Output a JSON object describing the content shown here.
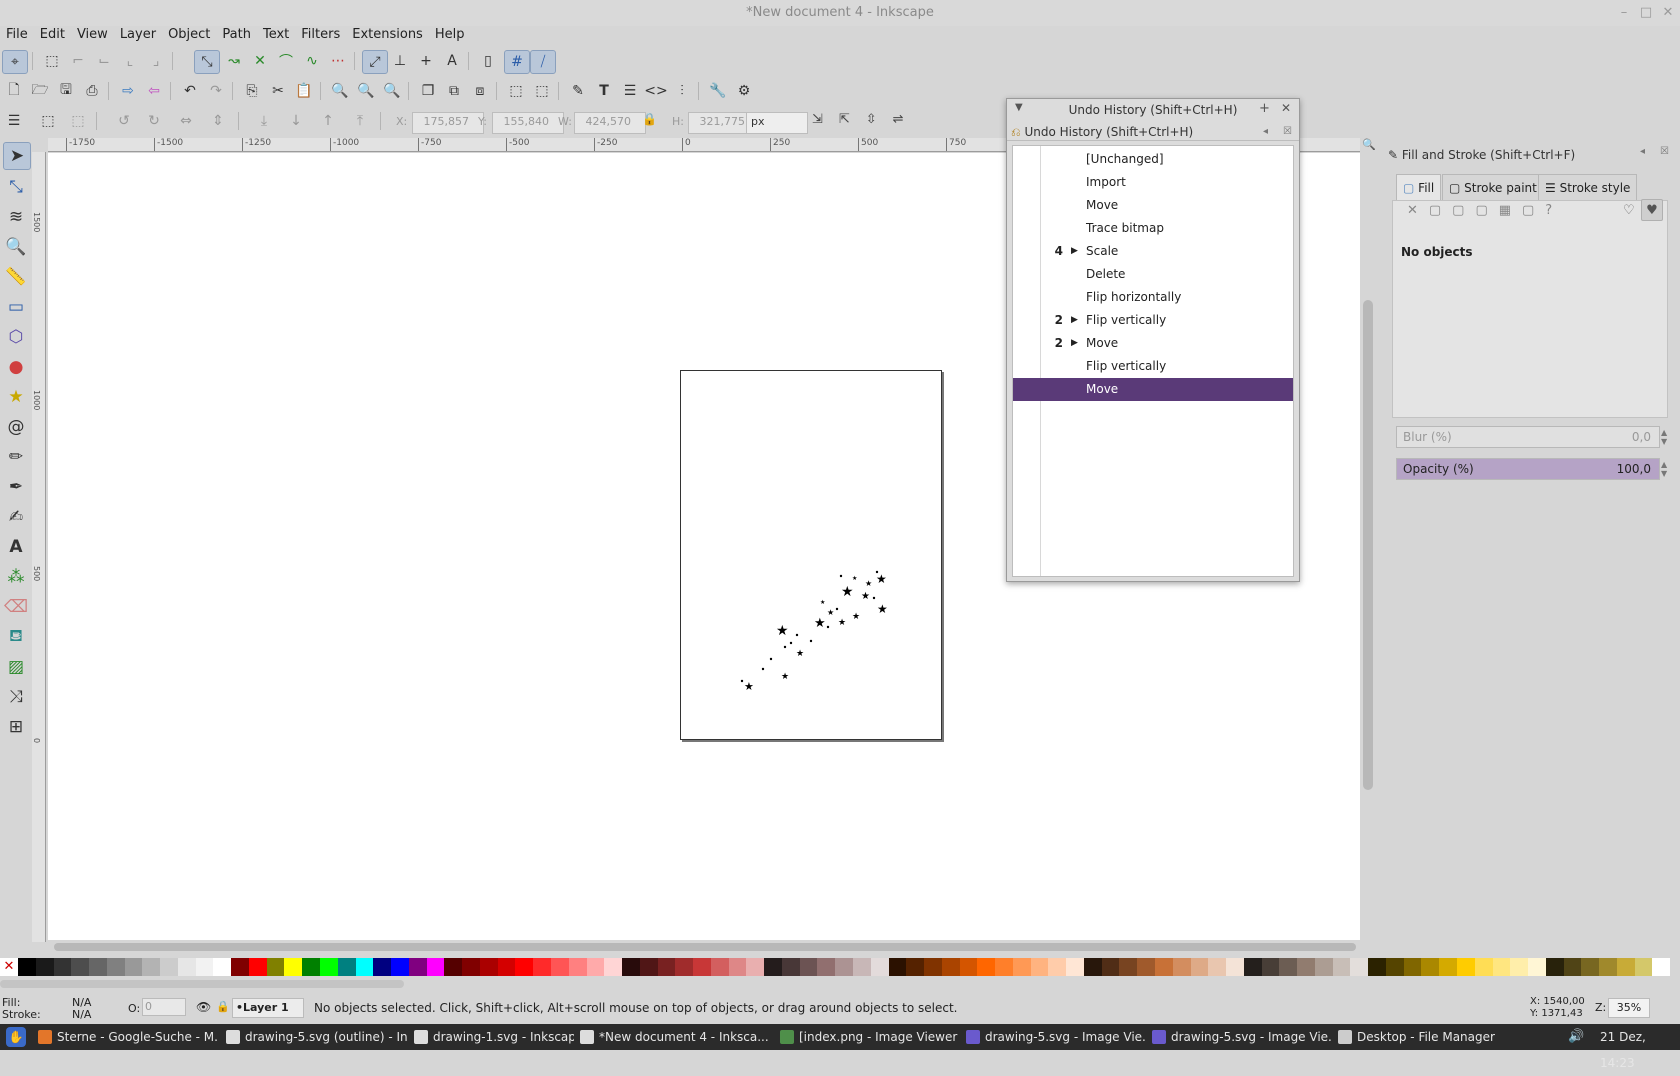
{
  "window": {
    "title": "*New document 4 - Inkscape"
  },
  "menu": [
    "File",
    "Edit",
    "View",
    "Layer",
    "Object",
    "Path",
    "Text",
    "Filters",
    "Extensions",
    "Help"
  ],
  "toolbar": {
    "x_label": "X:",
    "x_value": "175,857",
    "y_label": "Y:",
    "y_value": "155,840",
    "w_label": "W:",
    "w_value": "424,570",
    "h_label": "H:",
    "h_value": "321,775",
    "unit": "px"
  },
  "rulers": {
    "horizontal": [
      "-1750",
      "-1500",
      "-1250",
      "-1000",
      "-750",
      "-500",
      "-250",
      "0",
      "250",
      "500",
      "750"
    ],
    "vertical": [
      "1500",
      "1000",
      "500",
      "0"
    ]
  },
  "undo_history": {
    "title": "Undo History (Shift+Ctrl+H)",
    "header": "Undo History (Shift+Ctrl+H)",
    "items": [
      {
        "count": "",
        "expander": false,
        "label": "[Unchanged]",
        "selected": false
      },
      {
        "count": "",
        "expander": false,
        "label": "Import",
        "selected": false
      },
      {
        "count": "",
        "expander": false,
        "label": "Move",
        "selected": false
      },
      {
        "count": "",
        "expander": false,
        "label": "Trace bitmap",
        "selected": false
      },
      {
        "count": "4",
        "expander": true,
        "label": "Scale",
        "selected": false
      },
      {
        "count": "",
        "expander": false,
        "label": "Delete",
        "selected": false
      },
      {
        "count": "",
        "expander": false,
        "label": "Flip horizontally",
        "selected": false
      },
      {
        "count": "2",
        "expander": true,
        "label": "Flip vertically",
        "selected": false
      },
      {
        "count": "2",
        "expander": true,
        "label": "Move",
        "selected": false
      },
      {
        "count": "",
        "expander": false,
        "label": "Flip vertically",
        "selected": false
      },
      {
        "count": "",
        "expander": false,
        "label": "Move",
        "selected": true
      }
    ]
  },
  "fill_stroke": {
    "title": "Fill and Stroke (Shift+Ctrl+F)",
    "tabs": [
      "Fill",
      "Stroke paint",
      "Stroke style"
    ],
    "message": "No objects",
    "blur_label": "Blur (%)",
    "blur_value": "0,0",
    "opacity_label": "Opacity (%)",
    "opacity_value": "100,0",
    "opacity_fraction": 1.0
  },
  "status": {
    "fill_label": "Fill:",
    "fill_value": "N/A",
    "stroke_label": "Stroke:",
    "stroke_value": "N/A",
    "o_label": "O:",
    "o_value": "0",
    "layer": "•Layer 1",
    "message": "No objects selected. Click, Shift+click, Alt+scroll mouse on top of objects, or drag around objects to select.",
    "cursor_x": "X: 1540,00",
    "cursor_y": "Y: 1371,43",
    "zoom_label": "Z:",
    "zoom": "35%"
  },
  "taskbar": {
    "tasks": [
      {
        "label": "Sterne - Google-Suche - M...",
        "color": "#e3762a"
      },
      {
        "label": "drawing-5.svg (outline) - In...",
        "color": "#dddddd"
      },
      {
        "label": "drawing-1.svg - Inkscape",
        "color": "#dddddd"
      },
      {
        "label": "*New document 4 - Inksca...",
        "color": "#dddddd"
      },
      {
        "label": "[index.png - Image Viewer ...",
        "color": "#4f8f4a"
      },
      {
        "label": "drawing-5.svg - Image Vie...",
        "color": "#6a5acd"
      },
      {
        "label": "drawing-5.svg - Image Vie...",
        "color": "#6a5acd"
      },
      {
        "label": "Desktop - File Manager",
        "color": "#cccccc"
      }
    ],
    "clock": "21 Dez, 14:23"
  },
  "palette": [
    "#000000",
    "#1a1a1a",
    "#333333",
    "#4d4d4d",
    "#666666",
    "#808080",
    "#999999",
    "#b3b3b3",
    "#cccccc",
    "#e6e6e6",
    "#f2f2f2",
    "#ffffff",
    "#800000",
    "#ff0000",
    "#808000",
    "#ffff00",
    "#008000",
    "#00ff00",
    "#008080",
    "#00ffff",
    "#000080",
    "#0000ff",
    "#800080",
    "#ff00ff",
    "#550000",
    "#800000",
    "#aa0000",
    "#d40000",
    "#ff0000",
    "#ff2a2a",
    "#ff5555",
    "#ff8080",
    "#ffaaaa",
    "#ffd5d5",
    "#280b0b",
    "#501616",
    "#782121",
    "#a02c2c",
    "#c83737",
    "#d35f5f",
    "#de8787",
    "#e9afaf",
    "#241c1c",
    "#483737",
    "#6c5353",
    "#916f6f",
    "#ac9393",
    "#c8b7b7",
    "#e3dbdb",
    "#2b1100",
    "#552200",
    "#803300",
    "#aa4400",
    "#d45500",
    "#ff6600",
    "#ff7f2a",
    "#ff9955",
    "#ffb380",
    "#ffccaa",
    "#ffe6d5",
    "#28170b",
    "#502d16",
    "#784421",
    "#a05a2c",
    "#c87137",
    "#d38d5f",
    "#deaa87",
    "#e9c6af",
    "#f4e3d7",
    "#241f1c",
    "#483e37",
    "#6c5d53",
    "#917c6f",
    "#ac9d93",
    "#c8beb7",
    "#e3dedb",
    "#2b2200",
    "#554400",
    "#806600",
    "#aa8800",
    "#d4aa00",
    "#ffcc00",
    "#ffdd55",
    "#ffe680",
    "#ffeeaa",
    "#fff6d5",
    "#28220b",
    "#504416",
    "#786721",
    "#a0892c",
    "#c8ab37",
    "#d4c86a",
    "#ffffff"
  ],
  "accent": "#5a3a78"
}
